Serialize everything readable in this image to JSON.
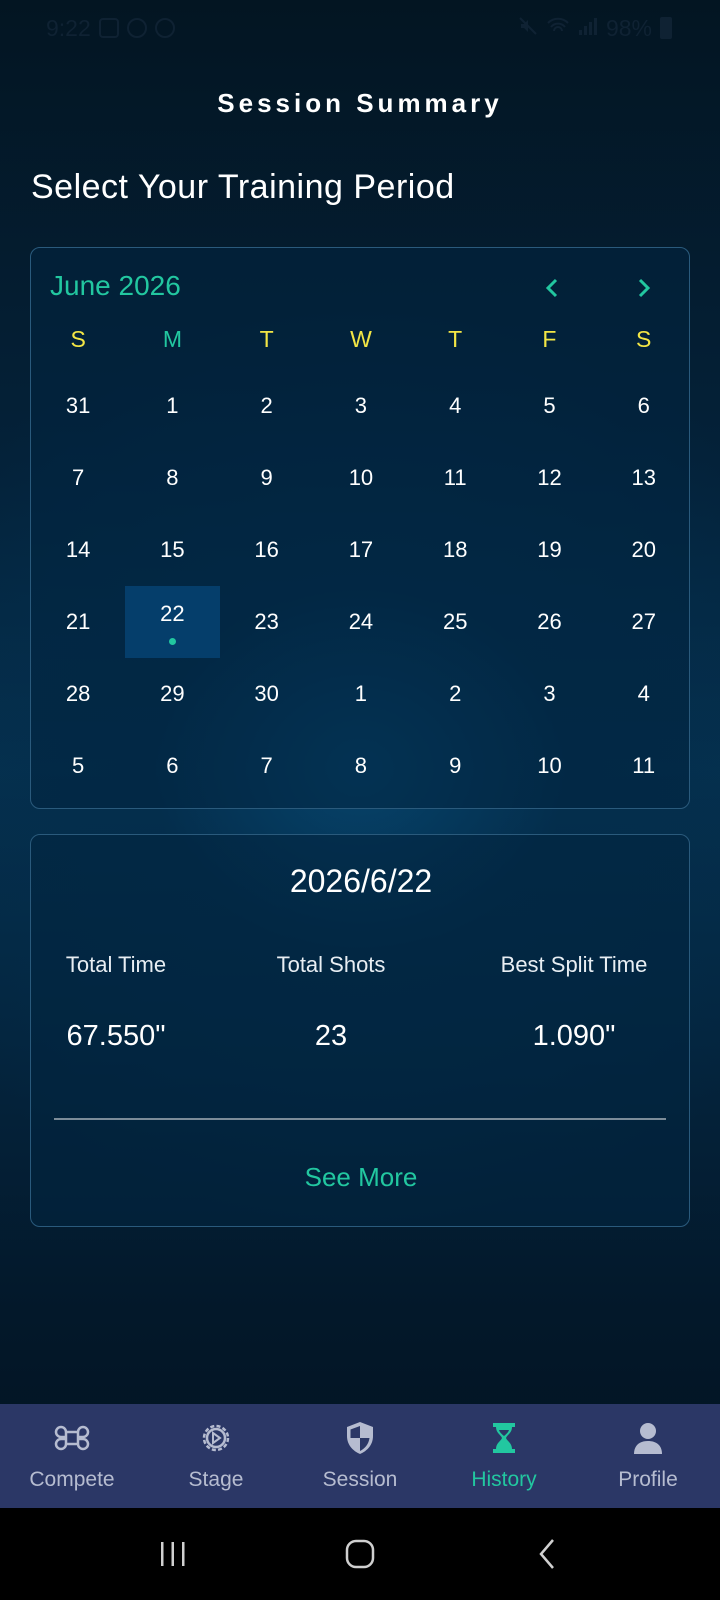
{
  "status_bar": {
    "time": "9:22",
    "battery": "98%"
  },
  "header": {
    "title": "Session Summary"
  },
  "section_title": "Select Your Training Period",
  "calendar": {
    "month_label": "June 2026",
    "weekdays": [
      "S",
      "M",
      "T",
      "W",
      "T",
      "F",
      "S"
    ],
    "weeks": [
      [
        "31",
        "1",
        "2",
        "3",
        "4",
        "5",
        "6"
      ],
      [
        "7",
        "8",
        "9",
        "10",
        "11",
        "12",
        "13"
      ],
      [
        "14",
        "15",
        "16",
        "17",
        "18",
        "19",
        "20"
      ],
      [
        "21",
        "22",
        "23",
        "24",
        "25",
        "26",
        "27"
      ],
      [
        "28",
        "29",
        "30",
        "1",
        "2",
        "3",
        "4"
      ],
      [
        "5",
        "6",
        "7",
        "8",
        "9",
        "10",
        "11"
      ]
    ],
    "selected_day": "22",
    "icons": {
      "prev": "chevron-left-icon",
      "next": "chevron-right-icon"
    }
  },
  "summary": {
    "date": "2026/6/22",
    "stats": [
      {
        "label": "Total Time",
        "value": "67.550\""
      },
      {
        "label": "Total Shots",
        "value": "23"
      },
      {
        "label": "Best Split Time",
        "value": "1.090\""
      }
    ],
    "see_more_label": "See More"
  },
  "bottom_nav": [
    {
      "label": "Compete",
      "icon": "command-icon",
      "active": false
    },
    {
      "label": "Stage",
      "icon": "gear-icon",
      "active": false
    },
    {
      "label": "Session",
      "icon": "shield-icon",
      "active": false
    },
    {
      "label": "History",
      "icon": "hourglass-icon",
      "active": true
    },
    {
      "label": "Profile",
      "icon": "person-icon",
      "active": false
    }
  ],
  "colors": {
    "accent": "#22c7a0",
    "weekday": "#f3e645",
    "nav_bg": "#2b3766",
    "selected_day_bg": "#053e6b"
  }
}
